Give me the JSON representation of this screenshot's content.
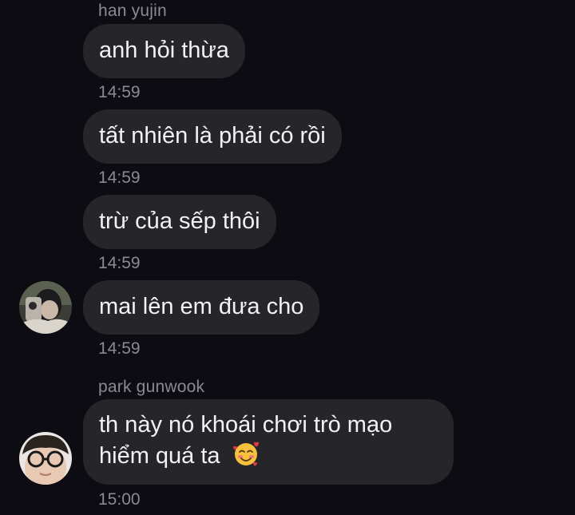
{
  "messages": [
    {
      "sender": "han yujin",
      "text": "anh hỏi thừa",
      "time": "14:59"
    },
    {
      "text": "tất nhiên là phải có rồi",
      "time": "14:59"
    },
    {
      "text": "trừ của sếp thôi",
      "time": "14:59"
    },
    {
      "text": "mai lên em đưa cho",
      "time": "14:59"
    },
    {
      "sender": "park gunwook",
      "text_line1": "th này nó khoái chơi trò mạo",
      "text_line2": "hiểm quá ta",
      "emoji": "smiling-face-with-hearts",
      "time": "15:00"
    }
  ]
}
